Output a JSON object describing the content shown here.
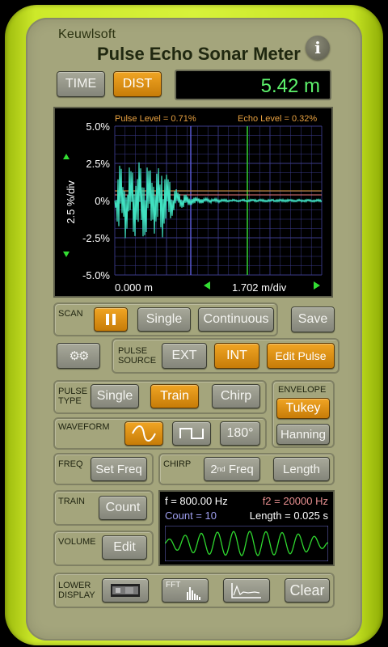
{
  "header": {
    "brand": "Keuwlsoft",
    "title": "Pulse Echo Sonar Meter",
    "info_label": "i"
  },
  "mode": {
    "time_label": "TIME",
    "dist_label": "DIST",
    "readout": "5.42 m"
  },
  "scope": {
    "pulse_level": "Pulse Level = 0.71%",
    "echo_level": "Echo Level = 0.32%",
    "y_ticks": [
      "5.0%",
      "2.5%",
      "0%",
      "-2.5%",
      "-5.0%"
    ],
    "y_scale": "2.5 %/div",
    "x_start": "0.000 m",
    "x_scale": "1.702 m/div",
    "colors": {
      "trace": "#40e0c0",
      "grid": "#3b3b8a",
      "pulse_marker": "#5d5ddf",
      "echo_marker": "#2fc82f",
      "pulse_line": "#e6a040",
      "echo_line": "#e87a7a"
    }
  },
  "scan": {
    "label": "SCAN",
    "single": "Single",
    "continuous": "Continuous"
  },
  "save_label": "Save",
  "source": {
    "label_line1": "PULSE",
    "label_line2": "SOURCE",
    "ext": "EXT",
    "int": "INT",
    "edit_pulse": "Edit Pulse"
  },
  "pulse_type": {
    "label_line1": "PULSE",
    "label_line2": "TYPE",
    "single": "Single",
    "train": "Train",
    "chirp": "Chirp"
  },
  "envelope": {
    "label": "ENVELOPE",
    "tukey": "Tukey",
    "hanning": "Hanning"
  },
  "waveform": {
    "label": "WAVEFORM",
    "phase": "180°"
  },
  "freq": {
    "label": "FREQ",
    "set_freq": "Set Freq"
  },
  "chirp": {
    "label": "CHIRP",
    "second_freq": "2",
    "second_freq_sup": "nd",
    "second_freq_suffix": " Freq",
    "length": "Length"
  },
  "train": {
    "label": "TRAIN",
    "count": "Count"
  },
  "volume": {
    "label": "VOLUME",
    "edit": "Edit"
  },
  "info_panel": {
    "f": "f = 800.00 Hz",
    "f2": "f2 = 20000 Hz",
    "count": "Count = 10",
    "length": "Length = 0.025 s"
  },
  "lower": {
    "label_line1": "LOWER",
    "label_line2": "DISPLAY",
    "fft": "FFT",
    "clear": "Clear"
  }
}
